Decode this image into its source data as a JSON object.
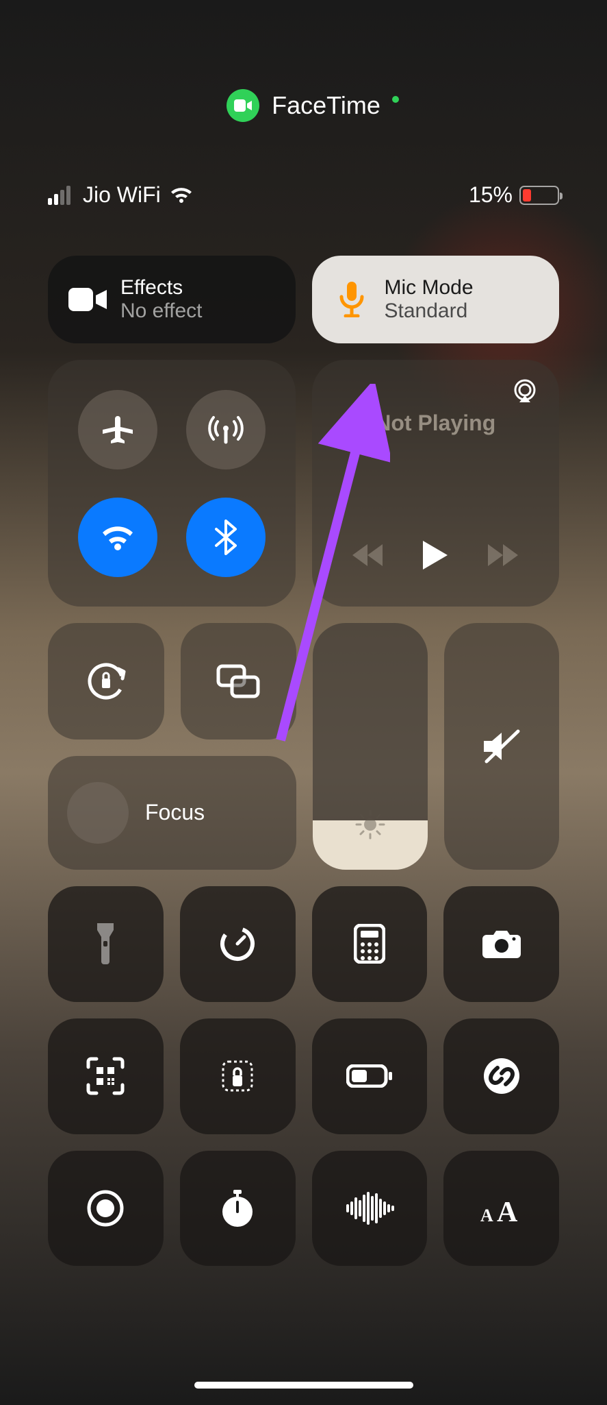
{
  "privacy_indicator": "camera-in-use",
  "active_app": {
    "name": "FaceTime",
    "icon": "facetime-video"
  },
  "status_bar": {
    "carrier": "Jio WiFi",
    "signal_bars": 2,
    "wifi": true,
    "battery_percent": "15%",
    "battery_low": true
  },
  "effects_tile": {
    "title": "Effects",
    "subtitle": "No effect"
  },
  "mic_tile": {
    "title": "Mic Mode",
    "subtitle": "Standard",
    "highlighted": true
  },
  "connectivity": {
    "airplane": false,
    "cellular": true,
    "wifi": true,
    "bluetooth": true
  },
  "media": {
    "status": "Not Playing",
    "airplay": true
  },
  "focus": {
    "label": "Focus",
    "mode": "off"
  },
  "brightness_level": 0.2,
  "volume_muted": true,
  "shortcut_rows": [
    [
      "flashlight",
      "timer",
      "calculator",
      "camera"
    ],
    [
      "qr-scanner",
      "guided-access",
      "low-power",
      "shazam"
    ],
    [
      "screen-record",
      "stopwatch",
      "voice-memos",
      "text-size"
    ]
  ],
  "annotation": {
    "type": "arrow",
    "points_to": "mic-mode-button"
  }
}
